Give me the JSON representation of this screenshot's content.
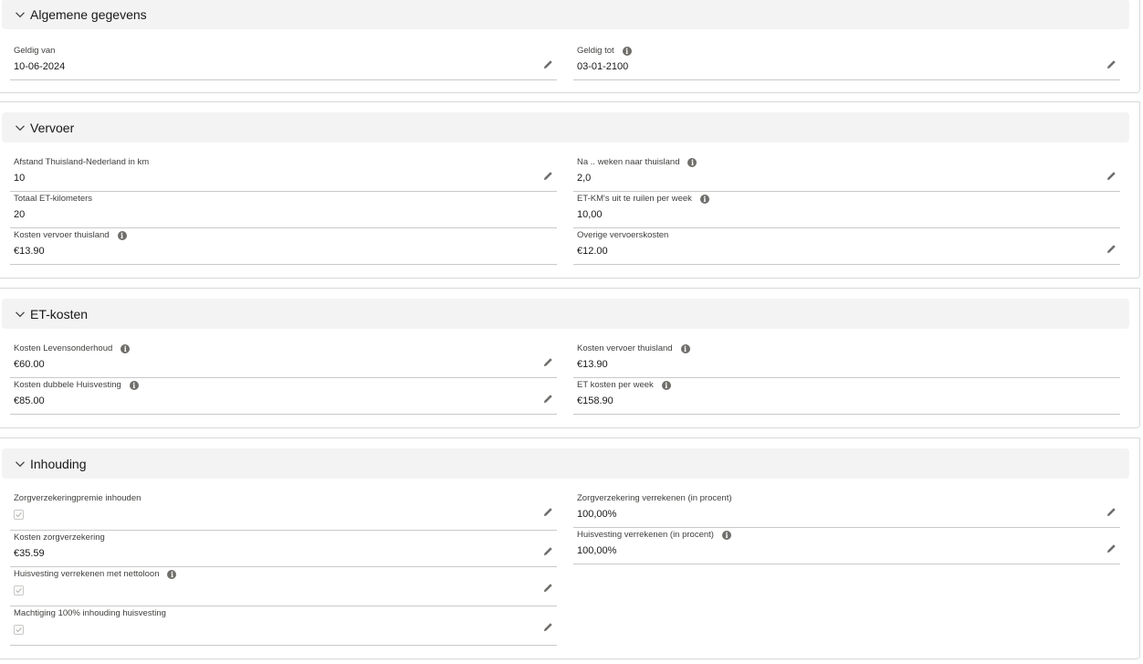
{
  "sections": {
    "general": {
      "title": "Algemene gegevens",
      "geldig_van": {
        "label": "Geldig van",
        "value": "10-06-2024"
      },
      "geldig_tot": {
        "label": "Geldig tot",
        "value": "03-01-2100"
      }
    },
    "transport": {
      "title": "Vervoer",
      "afstand": {
        "label": "Afstand Thuisland-Nederland in km",
        "value": "10"
      },
      "weken": {
        "label": "Na .. weken naar thuisland",
        "value": "2,0"
      },
      "totaal_et_km": {
        "label": "Totaal ET-kilometers",
        "value": "20"
      },
      "et_km_ruilen": {
        "label": "ET-KM's uit te ruilen per week",
        "value": "10,00"
      },
      "kosten_vervoer": {
        "label": "Kosten vervoer thuisland",
        "value": "€13.90"
      },
      "overige": {
        "label": "Overige vervoerskosten",
        "value": "€12.00"
      }
    },
    "et_costs": {
      "title": "ET-kosten",
      "levensonderhoud": {
        "label": "Kosten Levensonderhoud",
        "value": "€60.00"
      },
      "vervoer_thuisland": {
        "label": "Kosten vervoer thuisland",
        "value": "€13.90"
      },
      "dubbele_huisvesting": {
        "label": "Kosten dubbele Huisvesting",
        "value": "€85.00"
      },
      "et_per_week": {
        "label": "ET kosten per week",
        "value": "€158.90"
      }
    },
    "deduction": {
      "title": "Inhouding",
      "zorg_premie": {
        "label": "Zorgverzekeringpremie inhouden",
        "checked": true
      },
      "zorg_procent": {
        "label": "Zorgverzekering verrekenen (in procent)",
        "value": "100,00%"
      },
      "kosten_zorg": {
        "label": "Kosten zorgverzekering",
        "value": "€35.59"
      },
      "huisv_procent": {
        "label": "Huisvesting verrekenen (in procent)",
        "value": "100,00%"
      },
      "huisv_nettoloon": {
        "label": "Huisvesting verrekenen met nettoloon",
        "checked": true
      },
      "machtiging": {
        "label": "Machtiging 100% inhouding huisvesting",
        "checked": true
      }
    }
  },
  "icons": {
    "collapse": "chevron-down-icon",
    "info": "info-icon",
    "edit": "pencil-icon",
    "check": "checkmark-icon"
  },
  "colors": {
    "header_bg": "#f3f3f3",
    "border": "#c9c9c9",
    "icon": "#706e6b"
  }
}
